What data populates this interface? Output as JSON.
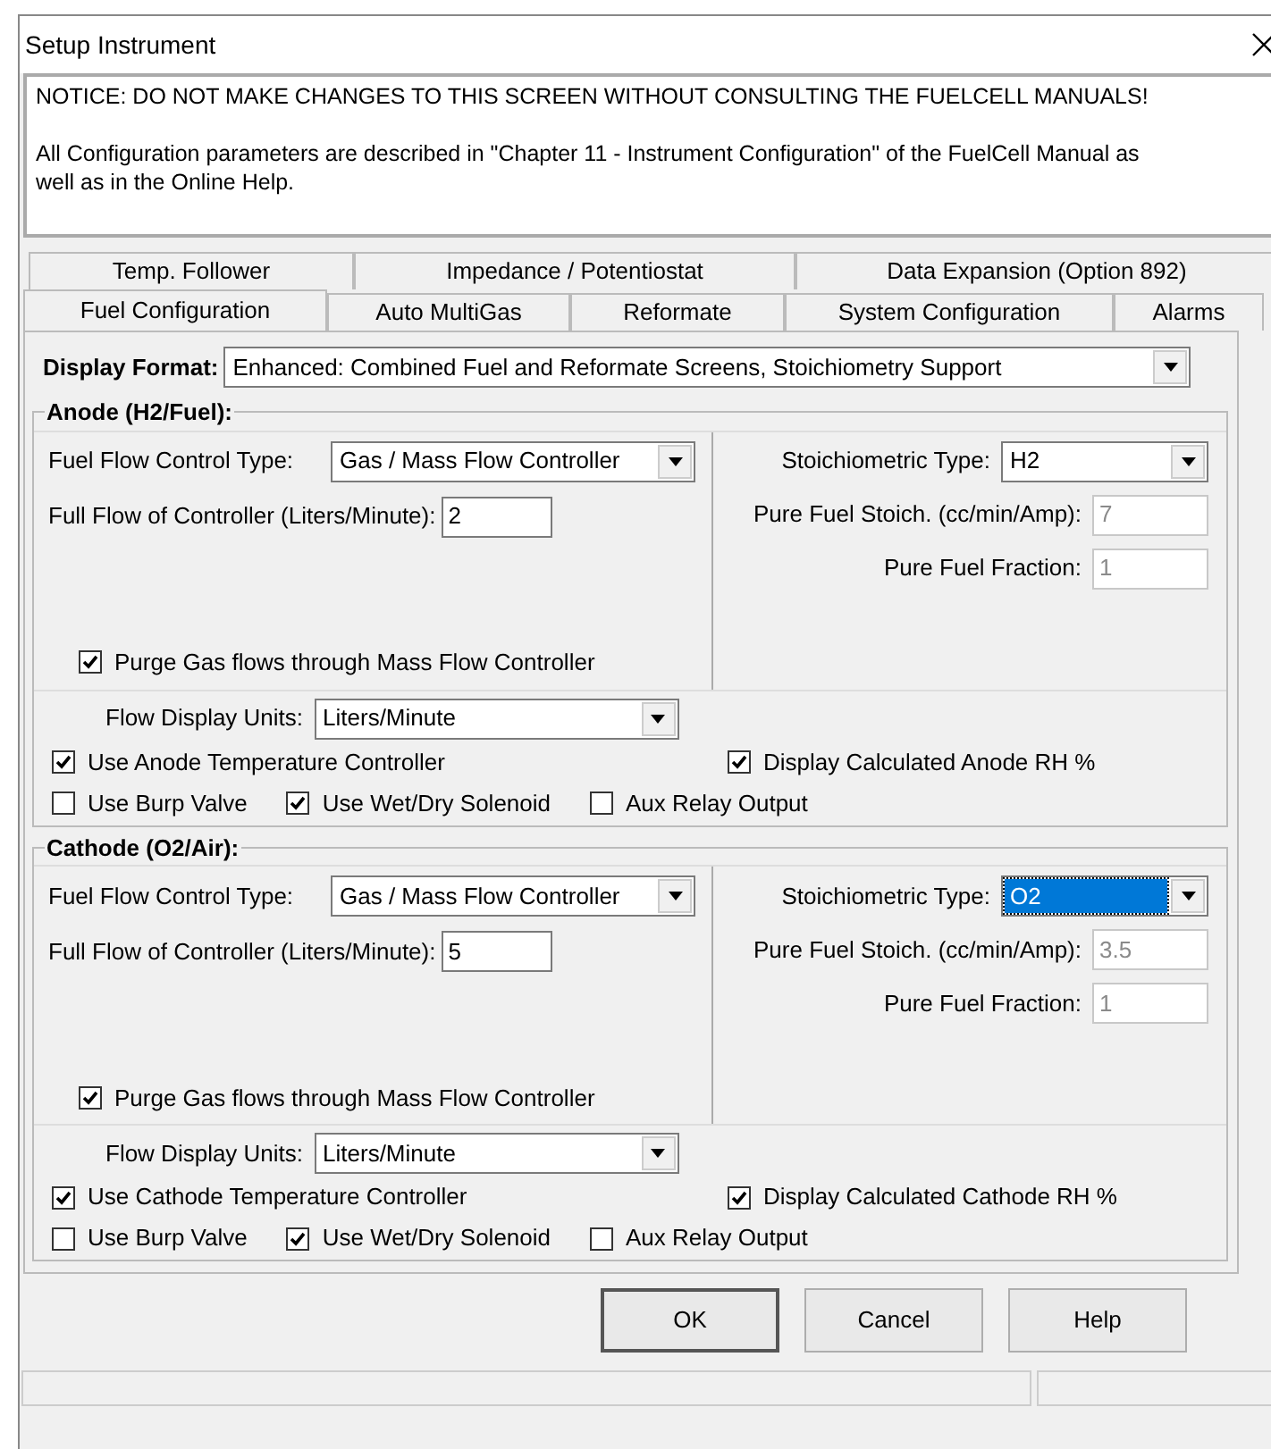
{
  "window": {
    "title": "Setup Instrument"
  },
  "notice": {
    "paragraphs": [
      "NOTICE:  DO NOT MAKE CHANGES TO THIS SCREEN WITHOUT CONSULTING THE FUELCELL MANUALS!",
      "All Configuration parameters are described in \"Chapter 11 - Instrument Configuration\" of the FuelCell Manual as well as in the Online Help."
    ]
  },
  "tab_rows": [
    [
      {
        "label": "Temp. Follower",
        "selected": false
      },
      {
        "label": "Impedance / Potentiostat",
        "selected": false
      },
      {
        "label": "Data Expansion (Option 892)",
        "selected": false
      }
    ],
    [
      {
        "label": "Fuel Configuration",
        "selected": true
      },
      {
        "label": "Auto MultiGas",
        "selected": false
      },
      {
        "label": "Reformate",
        "selected": false
      },
      {
        "label": "System Configuration",
        "selected": false
      },
      {
        "label": "Alarms",
        "selected": false
      }
    ]
  ],
  "display_format": {
    "label": "Display Format:",
    "value": "Enhanced: Combined Fuel and Reformate Screens, Stoichiometry Support"
  },
  "sections": [
    {
      "title": "Anode (H2/Fuel):",
      "fuel_flow_control_type": {
        "label": "Fuel Flow Control Type:",
        "value": "Gas / Mass Flow Controller"
      },
      "full_flow": {
        "label": "Full Flow of Controller (Liters/Minute):",
        "value": "2"
      },
      "purge": {
        "label": "Purge Gas flows through Mass Flow Controller",
        "checked": true
      },
      "stoichiometric_type": {
        "label": "Stoichiometric Type:",
        "value": "H2",
        "highlighted": false
      },
      "pure_fuel_stoich": {
        "label": "Pure Fuel Stoich. (cc/min/Amp):",
        "value": "7",
        "disabled": true
      },
      "pure_fuel_fraction": {
        "label": "Pure Fuel Fraction:",
        "value": "1",
        "disabled": true
      },
      "flow_display_units": {
        "label": "Flow Display Units:",
        "value": "Liters/Minute"
      },
      "checkbox_rows": [
        [
          {
            "label": "Use Anode Temperature Controller",
            "checked": true
          },
          {
            "label": "Display Calculated Anode RH %",
            "checked": true
          }
        ],
        [
          {
            "label": "Use Burp Valve",
            "checked": false
          },
          {
            "label": "Use Wet/Dry Solenoid",
            "checked": true
          },
          {
            "label": "Aux Relay Output",
            "checked": false
          }
        ]
      ]
    },
    {
      "title": "Cathode (O2/Air):",
      "fuel_flow_control_type": {
        "label": "Fuel Flow Control Type:",
        "value": "Gas / Mass Flow Controller"
      },
      "full_flow": {
        "label": "Full Flow of Controller (Liters/Minute):",
        "value": "5"
      },
      "purge": {
        "label": "Purge Gas flows through Mass Flow Controller",
        "checked": true
      },
      "stoichiometric_type": {
        "label": "Stoichiometric Type:",
        "value": "O2",
        "highlighted": true
      },
      "pure_fuel_stoich": {
        "label": "Pure Fuel Stoich. (cc/min/Amp):",
        "value": "3.5",
        "disabled": true
      },
      "pure_fuel_fraction": {
        "label": "Pure Fuel Fraction:",
        "value": "1",
        "disabled": true
      },
      "flow_display_units": {
        "label": "Flow Display Units:",
        "value": "Liters/Minute"
      },
      "checkbox_rows": [
        [
          {
            "label": "Use Cathode Temperature Controller",
            "checked": true
          },
          {
            "label": "Display Calculated Cathode RH %",
            "checked": true
          }
        ],
        [
          {
            "label": "Use Burp Valve",
            "checked": false
          },
          {
            "label": "Use Wet/Dry Solenoid",
            "checked": true
          },
          {
            "label": "Aux Relay Output",
            "checked": false
          }
        ]
      ]
    }
  ],
  "buttons": [
    {
      "label": "OK",
      "default": true
    },
    {
      "label": "Cancel",
      "default": false
    },
    {
      "label": "Help",
      "default": false
    }
  ]
}
